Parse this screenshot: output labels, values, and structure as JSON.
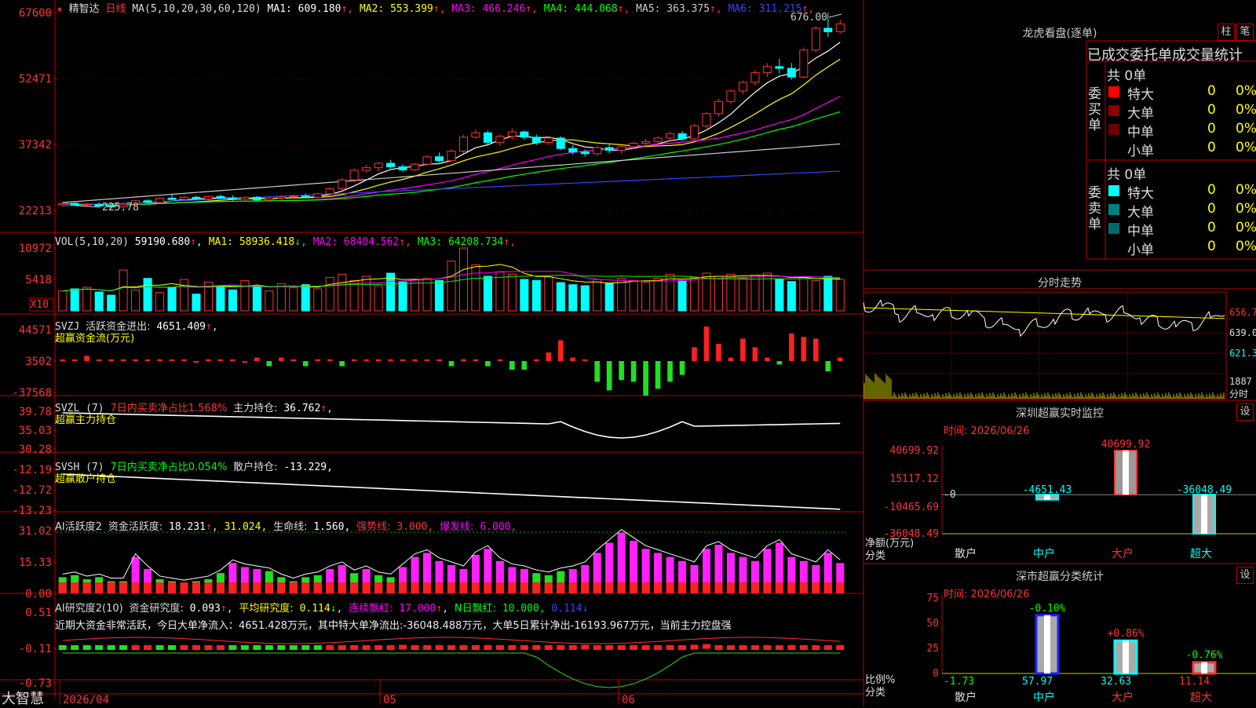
{
  "stock_name": "精智达",
  "period": "日线",
  "star_marks": "★",
  "up_marker": "↑",
  "price_panel": {
    "ma_header": "MA(5,10,20,30,60,120)",
    "ma": [
      {
        "label": "MA1:",
        "value": "609.180",
        "color": "#ffffff"
      },
      {
        "label": "MA2:",
        "value": "553.399",
        "color": "#ffff00"
      },
      {
        "label": "MA3:",
        "value": "466.246",
        "color": "#ff00ff"
      },
      {
        "label": "MA4:",
        "value": "444.068",
        "color": "#00ff00"
      },
      {
        "label": "MA5:",
        "value": "363.375",
        "color": "#cccccc"
      },
      {
        "label": "MA6:",
        "value": "311.215",
        "color": "#3344ff"
      }
    ],
    "y_labels": [
      "67600",
      "52471",
      "37342",
      "22213"
    ],
    "high_label": "676.00",
    "low_label": "225.78"
  },
  "vol_panel": {
    "header": "VOL(5,10,20)",
    "value": "59190.680",
    "ma": [
      {
        "label": "MA1:",
        "value": "58936.418",
        "arrow": "↓",
        "color": "#ffff00"
      },
      {
        "label": "MA2:",
        "value": "68404.562",
        "arrow": "↑",
        "color": "#ff00ff"
      },
      {
        "label": "MA3:",
        "value": "64208.734",
        "arrow": "↑",
        "color": "#00ff00"
      }
    ],
    "y_labels": [
      "10972",
      "5418"
    ],
    "unit": "X10"
  },
  "svzj_panel": {
    "name": "SVZJ",
    "text": "活跃资金进出:",
    "value": "4651.409",
    "subtitle": "超赢资金流(万元)",
    "y_labels": [
      "44571",
      "3502",
      "-37568"
    ]
  },
  "svzl_panel": {
    "name": "SVZL  (7)",
    "text1": "7日内买卖净占比1.568%",
    "text2": "主力持仓:",
    "value": "36.762",
    "subtitle": "超赢主力持仓",
    "y_labels": [
      "39.78",
      "35.03",
      "30.28"
    ]
  },
  "svsh_panel": {
    "name": "SVSH  (7)",
    "text1": "7日内买卖净占比0.054%",
    "text2": "散户持仓:",
    "value": "-13.229,",
    "subtitle": "超赢散户持仓",
    "y_labels": [
      "-12.19",
      "-12.72",
      "-13.23"
    ]
  },
  "ai_active_panel": {
    "name": "AI活跃度2",
    "text1": "资金活跃度:",
    "value1": "18.231",
    "value2": "31.024,",
    "text3": "生命线:",
    "value3": "1.560,",
    "text4": "强势线:",
    "value4": "3.000,",
    "text5": "爆发线:",
    "value5": "6.000,",
    "y_labels": [
      "31.02",
      "15.33",
      "0.00"
    ]
  },
  "ai_research_panel": {
    "name": "AI研究度2(10)",
    "text1": "资金研究度:",
    "value1": "0.093",
    "text2": "平均研究度:",
    "value2": "0.114",
    "text3": "连续飘红:",
    "value3": "17.000",
    "text4": "N日飘红:",
    "value4": "10.000,",
    "value5": "0.114",
    "summary": "近期大资金非常活跃，今日大单净流入：4651.428万元，其中特大单净流出:-36048.488万元，大单5日累计净出-16193.967万元，当前主力控盘强",
    "y_labels": [
      "0.51",
      "-0.11",
      "-0.73"
    ]
  },
  "x_axis": {
    "labels": [
      "2026/04",
      "05",
      "06"
    ]
  },
  "brand": "大智慧",
  "longhu": {
    "title": "龙虎看盘(逐单)",
    "btn1": "柱",
    "btn2": "笔",
    "tabs": "已成交委托单成交量统计",
    "buy_label": "委买单",
    "sell_label": "委卖单",
    "buy_total": "共 0单",
    "sell_total": "共 0单",
    "buy_rows": [
      {
        "name": "特大",
        "count": "0",
        "pct": "0%",
        "color": "#ff0000"
      },
      {
        "name": "大单",
        "count": "0",
        "pct": "0%",
        "color": "#8b0000"
      },
      {
        "name": "中单",
        "count": "0",
        "pct": "0%",
        "color": "#6b0000"
      },
      {
        "name": "小单",
        "count": "0",
        "pct": "0%",
        "color": "#000000"
      }
    ],
    "sell_rows": [
      {
        "name": "特大",
        "count": "0",
        "pct": "0%",
        "color": "#00ffff"
      },
      {
        "name": "大单",
        "count": "0",
        "pct": "0%",
        "color": "#008080"
      },
      {
        "name": "中单",
        "count": "0",
        "pct": "0%",
        "color": "#006b6b"
      },
      {
        "name": "小单",
        "count": "0",
        "pct": "0%",
        "color": "#000000"
      }
    ]
  },
  "fenshi": {
    "title": "分时走势",
    "y_labels": [
      "656.7",
      "639.0",
      "621.3"
    ],
    "vol_label": "1887",
    "unit_label": "分时"
  },
  "monitor": {
    "title": "深圳超赢实时监控",
    "set_label": "设",
    "date": "时间: 2026/06/26",
    "y_labels": [
      "40699.92",
      "15117.12",
      "-0",
      "-10465.69",
      "-36048.49"
    ],
    "unit_label": "净额(万元)",
    "axis_label": "分类",
    "chart_data": {
      "type": "bar",
      "categories": [
        "散户",
        "中户",
        "大户",
        "超大"
      ],
      "values": [
        0,
        -4651.43,
        40699.92,
        -36048.49
      ],
      "labels": [
        "",
        "-4651.43",
        "40699.92",
        "-36048.49"
      ],
      "ylim": [
        -36048.49,
        40699.92
      ]
    }
  },
  "classify": {
    "title": "深市超赢分类统计",
    "set_label": "设",
    "date": "时间: 2026/06/26",
    "y_labels": [
      "75",
      "50",
      "25",
      "0"
    ],
    "unit_label": "比例%",
    "axis_label": "分类",
    "chart_data": {
      "type": "bar",
      "categories": [
        "散户",
        "中户",
        "大户",
        "超大"
      ],
      "values": [
        -1.73,
        57.97,
        32.63,
        11.14
      ],
      "changes": [
        "",
        "-0.10%",
        "+0.86%",
        "-0.76%"
      ],
      "ylim": [
        0,
        75
      ]
    }
  },
  "chart_data": {
    "type": "candlestick",
    "date_range_start": "2026/04",
    "y_range": [
      22213,
      67600
    ],
    "candles": [
      [
        235,
        239,
        231,
        238
      ],
      [
        238,
        241,
        233,
        234
      ],
      [
        234,
        240,
        230,
        236
      ],
      [
        236,
        240,
        231,
        232
      ],
      [
        232,
        235,
        226,
        230
      ],
      [
        230,
        238,
        228,
        236
      ],
      [
        236,
        246,
        234,
        244
      ],
      [
        244,
        248,
        238,
        240
      ],
      [
        240,
        252,
        238,
        250
      ],
      [
        250,
        258,
        246,
        247
      ],
      [
        247,
        255,
        244,
        252
      ],
      [
        252,
        256,
        246,
        248
      ],
      [
        248,
        256,
        245,
        254
      ],
      [
        254,
        258,
        248,
        250
      ],
      [
        250,
        256,
        244,
        248
      ],
      [
        248,
        254,
        242,
        252
      ],
      [
        252,
        255,
        244,
        246
      ],
      [
        246,
        252,
        242,
        250
      ],
      [
        250,
        256,
        246,
        253
      ],
      [
        253,
        258,
        249,
        255
      ],
      [
        255,
        261,
        250,
        252
      ],
      [
        252,
        262,
        250,
        260
      ],
      [
        260,
        275,
        256,
        272
      ],
      [
        272,
        296,
        268,
        292
      ],
      [
        292,
        318,
        286,
        314
      ],
      [
        314,
        326,
        308,
        320
      ],
      [
        320,
        334,
        312,
        330
      ],
      [
        330,
        338,
        318,
        322
      ],
      [
        322,
        328,
        310,
        315
      ],
      [
        315,
        330,
        312,
        328
      ],
      [
        328,
        348,
        324,
        345
      ],
      [
        345,
        355,
        332,
        336
      ],
      [
        336,
        362,
        332,
        358
      ],
      [
        358,
        395,
        352,
        390
      ],
      [
        390,
        408,
        386,
        400
      ],
      [
        400,
        405,
        372,
        378
      ],
      [
        378,
        396,
        370,
        392
      ],
      [
        392,
        410,
        384,
        402
      ],
      [
        402,
        406,
        384,
        390
      ],
      [
        390,
        396,
        372,
        378
      ],
      [
        378,
        392,
        372,
        388
      ],
      [
        388,
        392,
        360,
        364
      ],
      [
        364,
        372,
        350,
        356
      ],
      [
        356,
        362,
        345,
        352
      ],
      [
        352,
        370,
        348,
        366
      ],
      [
        366,
        374,
        354,
        360
      ],
      [
        360,
        372,
        352,
        368
      ],
      [
        368,
        380,
        362,
        376
      ],
      [
        376,
        386,
        366,
        380
      ],
      [
        380,
        392,
        372,
        388
      ],
      [
        388,
        402,
        380,
        398
      ],
      [
        398,
        404,
        382,
        386
      ],
      [
        386,
        420,
        382,
        416
      ],
      [
        416,
        448,
        410,
        444
      ],
      [
        444,
        478,
        438,
        472
      ],
      [
        472,
        500,
        466,
        496
      ],
      [
        496,
        520,
        488,
        516
      ],
      [
        516,
        544,
        508,
        538
      ],
      [
        538,
        560,
        528,
        552
      ],
      [
        552,
        570,
        536,
        548
      ],
      [
        548,
        560,
        522,
        528
      ],
      [
        528,
        596,
        524,
        590
      ],
      [
        590,
        645,
        584,
        640
      ],
      [
        640,
        676,
        620,
        632
      ],
      [
        632,
        660,
        628,
        650
      ]
    ],
    "volumes": [
      38,
      42,
      45,
      36,
      30,
      78,
      40,
      62,
      35,
      45,
      60,
      32,
      55,
      48,
      40,
      58,
      46,
      38,
      52,
      44,
      50,
      42,
      64,
      70,
      58,
      66,
      48,
      72,
      55,
      60,
      62,
      58,
      95,
      120,
      88,
      66,
      74,
      70,
      60,
      58,
      65,
      54,
      50,
      48,
      60,
      52,
      62,
      58,
      55,
      62,
      70,
      58,
      64,
      72,
      66,
      70,
      62,
      68,
      72,
      60,
      56,
      64,
      58,
      66,
      60
    ],
    "svzj": [
      1,
      1,
      3,
      1,
      1,
      1,
      1,
      1,
      1,
      1,
      1,
      0,
      1,
      1,
      1,
      0,
      2,
      -3,
      2,
      1,
      -3,
      1,
      1,
      -3,
      1,
      1,
      1,
      1,
      1,
      1,
      1,
      1,
      -3,
      1,
      1,
      -3,
      1,
      -5,
      -5,
      1,
      5,
      12,
      2,
      1,
      -12,
      -17,
      -11,
      -12,
      -20,
      -16,
      -12,
      -8,
      8,
      20,
      10,
      2,
      13,
      8,
      2,
      -2,
      16,
      14,
      13,
      -6,
      2,
      2,
      2
    ],
    "active": [
      8,
      9,
      7,
      8,
      6,
      6,
      18,
      12,
      7,
      6,
      5,
      6,
      7,
      10,
      15,
      13,
      12,
      11,
      8,
      6,
      8,
      9,
      12,
      14,
      10,
      12,
      9,
      8,
      13,
      18,
      20,
      16,
      14,
      12,
      19,
      22,
      16,
      13,
      12,
      10,
      9,
      11,
      12,
      14,
      20,
      25,
      30,
      26,
      22,
      20,
      18,
      16,
      14,
      22,
      24,
      20,
      18,
      16,
      22,
      25,
      18,
      16,
      14,
      20,
      15
    ],
    "research": [
      -0.1,
      -0.11,
      -0.12,
      -0.1,
      -0.09,
      -0.08,
      -0.05,
      -0.06,
      -0.07,
      -0.08,
      -0.06,
      -0.04,
      -0.05,
      -0.06,
      -0.07,
      -0.08,
      -0.09,
      -0.1,
      -0.11,
      -0.12,
      -0.1,
      -0.08,
      -0.05,
      -0.04,
      -0.03,
      -0.02,
      -0.01,
      0.0,
      0.05,
      0.02,
      0.01,
      0.03,
      0.0,
      -0.03,
      -0.05,
      -0.06,
      -0.04,
      -0.03,
      -0.02,
      -0.01,
      0.01,
      0.02,
      0.03,
      0.05,
      0.04,
      0.03,
      0.02,
      0.01,
      0.0,
      0.02,
      0.03,
      0.04,
      0.05,
      0.06,
      0.04,
      0.03,
      0.02,
      0.01,
      0.0,
      0.02,
      0.03,
      0.04,
      0.03,
      0.02,
      0.01
    ]
  }
}
